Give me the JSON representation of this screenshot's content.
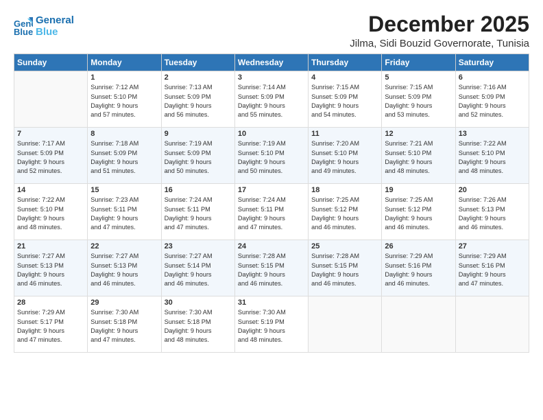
{
  "logo": {
    "line1": "General",
    "line2": "Blue"
  },
  "title": "December 2025",
  "location": "Jilma, Sidi Bouzid Governorate, Tunisia",
  "days_header": [
    "Sunday",
    "Monday",
    "Tuesday",
    "Wednesday",
    "Thursday",
    "Friday",
    "Saturday"
  ],
  "weeks": [
    [
      {
        "day": "",
        "info": ""
      },
      {
        "day": "1",
        "info": "Sunrise: 7:12 AM\nSunset: 5:10 PM\nDaylight: 9 hours\nand 57 minutes."
      },
      {
        "day": "2",
        "info": "Sunrise: 7:13 AM\nSunset: 5:09 PM\nDaylight: 9 hours\nand 56 minutes."
      },
      {
        "day": "3",
        "info": "Sunrise: 7:14 AM\nSunset: 5:09 PM\nDaylight: 9 hours\nand 55 minutes."
      },
      {
        "day": "4",
        "info": "Sunrise: 7:15 AM\nSunset: 5:09 PM\nDaylight: 9 hours\nand 54 minutes."
      },
      {
        "day": "5",
        "info": "Sunrise: 7:15 AM\nSunset: 5:09 PM\nDaylight: 9 hours\nand 53 minutes."
      },
      {
        "day": "6",
        "info": "Sunrise: 7:16 AM\nSunset: 5:09 PM\nDaylight: 9 hours\nand 52 minutes."
      }
    ],
    [
      {
        "day": "7",
        "info": "Sunrise: 7:17 AM\nSunset: 5:09 PM\nDaylight: 9 hours\nand 52 minutes."
      },
      {
        "day": "8",
        "info": "Sunrise: 7:18 AM\nSunset: 5:09 PM\nDaylight: 9 hours\nand 51 minutes."
      },
      {
        "day": "9",
        "info": "Sunrise: 7:19 AM\nSunset: 5:09 PM\nDaylight: 9 hours\nand 50 minutes."
      },
      {
        "day": "10",
        "info": "Sunrise: 7:19 AM\nSunset: 5:10 PM\nDaylight: 9 hours\nand 50 minutes."
      },
      {
        "day": "11",
        "info": "Sunrise: 7:20 AM\nSunset: 5:10 PM\nDaylight: 9 hours\nand 49 minutes."
      },
      {
        "day": "12",
        "info": "Sunrise: 7:21 AM\nSunset: 5:10 PM\nDaylight: 9 hours\nand 48 minutes."
      },
      {
        "day": "13",
        "info": "Sunrise: 7:22 AM\nSunset: 5:10 PM\nDaylight: 9 hours\nand 48 minutes."
      }
    ],
    [
      {
        "day": "14",
        "info": "Sunrise: 7:22 AM\nSunset: 5:10 PM\nDaylight: 9 hours\nand 48 minutes."
      },
      {
        "day": "15",
        "info": "Sunrise: 7:23 AM\nSunset: 5:11 PM\nDaylight: 9 hours\nand 47 minutes."
      },
      {
        "day": "16",
        "info": "Sunrise: 7:24 AM\nSunset: 5:11 PM\nDaylight: 9 hours\nand 47 minutes."
      },
      {
        "day": "17",
        "info": "Sunrise: 7:24 AM\nSunset: 5:11 PM\nDaylight: 9 hours\nand 47 minutes."
      },
      {
        "day": "18",
        "info": "Sunrise: 7:25 AM\nSunset: 5:12 PM\nDaylight: 9 hours\nand 46 minutes."
      },
      {
        "day": "19",
        "info": "Sunrise: 7:25 AM\nSunset: 5:12 PM\nDaylight: 9 hours\nand 46 minutes."
      },
      {
        "day": "20",
        "info": "Sunrise: 7:26 AM\nSunset: 5:13 PM\nDaylight: 9 hours\nand 46 minutes."
      }
    ],
    [
      {
        "day": "21",
        "info": "Sunrise: 7:27 AM\nSunset: 5:13 PM\nDaylight: 9 hours\nand 46 minutes."
      },
      {
        "day": "22",
        "info": "Sunrise: 7:27 AM\nSunset: 5:13 PM\nDaylight: 9 hours\nand 46 minutes."
      },
      {
        "day": "23",
        "info": "Sunrise: 7:27 AM\nSunset: 5:14 PM\nDaylight: 9 hours\nand 46 minutes."
      },
      {
        "day": "24",
        "info": "Sunrise: 7:28 AM\nSunset: 5:15 PM\nDaylight: 9 hours\nand 46 minutes."
      },
      {
        "day": "25",
        "info": "Sunrise: 7:28 AM\nSunset: 5:15 PM\nDaylight: 9 hours\nand 46 minutes."
      },
      {
        "day": "26",
        "info": "Sunrise: 7:29 AM\nSunset: 5:16 PM\nDaylight: 9 hours\nand 46 minutes."
      },
      {
        "day": "27",
        "info": "Sunrise: 7:29 AM\nSunset: 5:16 PM\nDaylight: 9 hours\nand 47 minutes."
      }
    ],
    [
      {
        "day": "28",
        "info": "Sunrise: 7:29 AM\nSunset: 5:17 PM\nDaylight: 9 hours\nand 47 minutes."
      },
      {
        "day": "29",
        "info": "Sunrise: 7:30 AM\nSunset: 5:18 PM\nDaylight: 9 hours\nand 47 minutes."
      },
      {
        "day": "30",
        "info": "Sunrise: 7:30 AM\nSunset: 5:18 PM\nDaylight: 9 hours\nand 48 minutes."
      },
      {
        "day": "31",
        "info": "Sunrise: 7:30 AM\nSunset: 5:19 PM\nDaylight: 9 hours\nand 48 minutes."
      },
      {
        "day": "",
        "info": ""
      },
      {
        "day": "",
        "info": ""
      },
      {
        "day": "",
        "info": ""
      }
    ]
  ]
}
